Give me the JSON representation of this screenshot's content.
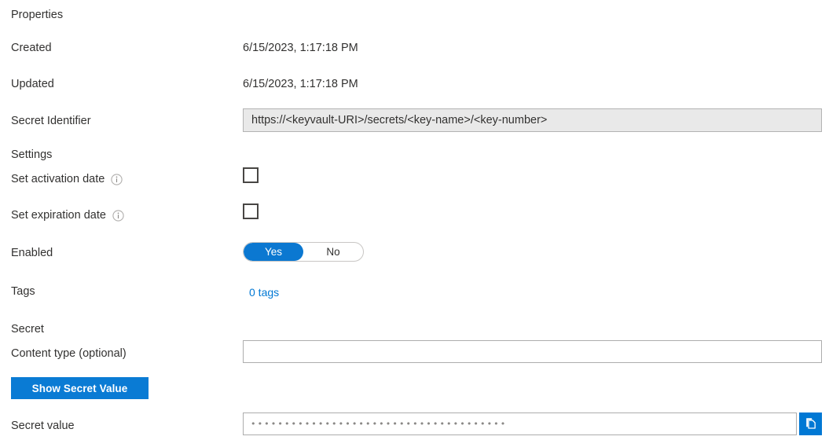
{
  "sections": {
    "properties_title": "Properties",
    "settings_title": "Settings",
    "secret_title": "Secret"
  },
  "properties": {
    "created_label": "Created",
    "created_value": "6/15/2023, 1:17:18 PM",
    "updated_label": "Updated",
    "updated_value": "6/15/2023, 1:17:18 PM",
    "secret_identifier_label": "Secret Identifier",
    "secret_identifier_value": "https://<keyvault-URI>/secrets/<key-name>/<key-number>"
  },
  "settings": {
    "activation_label": "Set activation date",
    "activation_checked": false,
    "expiration_label": "Set expiration date",
    "expiration_checked": false,
    "enabled_label": "Enabled",
    "enabled_yes": "Yes",
    "enabled_no": "No",
    "enabled_selected": "Yes",
    "tags_label": "Tags",
    "tags_value": "0 tags"
  },
  "secret": {
    "content_type_label": "Content type (optional)",
    "content_type_value": "",
    "content_type_placeholder": "",
    "show_secret_button": "Show Secret Value",
    "secret_value_label": "Secret value",
    "secret_value_masked": "••••••••••••••••••••••••••••••••••••••"
  },
  "icons": {
    "info": "info-icon",
    "copy": "copy-icon"
  },
  "colors": {
    "accent_blue": "#0078d4",
    "toggle_blue": "#0b78d1",
    "link_blue": "#0078d4",
    "text": "#323130",
    "readonly_bg": "#e9e9e9",
    "input_border": "#adadad"
  }
}
